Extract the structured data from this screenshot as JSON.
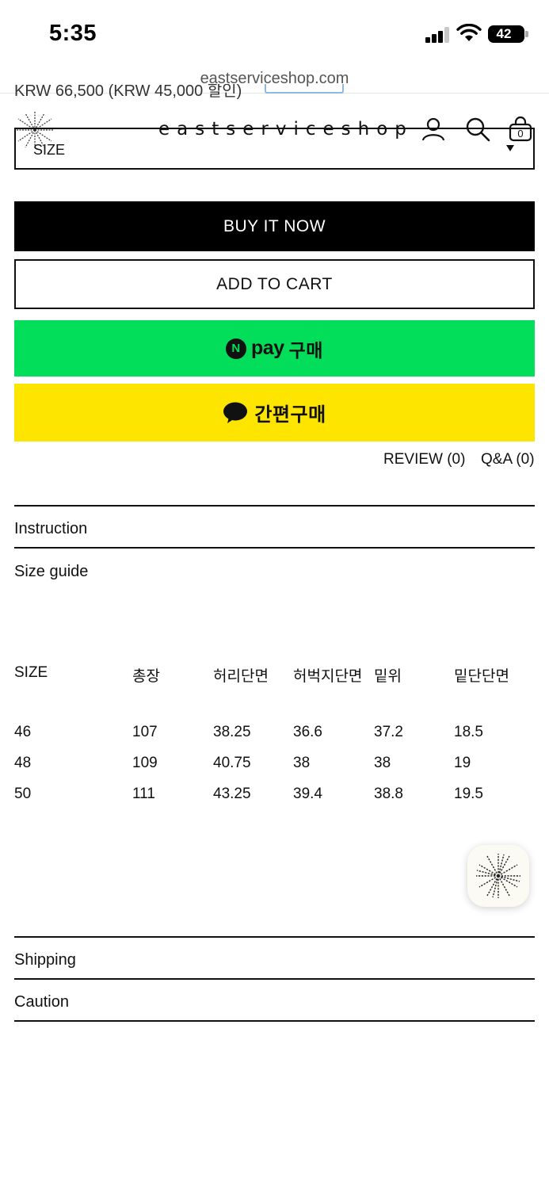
{
  "status_bar": {
    "time": "5:35",
    "battery": "42"
  },
  "browser": {
    "url": "eastserviceshop.com"
  },
  "product": {
    "price_partial": "KRW 66,500 (KRW 45,000 할인)"
  },
  "header": {
    "brand": "eastserviceshop",
    "cart_count": "0"
  },
  "options": {
    "size_select_label": "SIZE"
  },
  "actions": {
    "buy_now": "BUY IT NOW",
    "add_to_cart": "ADD TO CART",
    "npay_badge": "N",
    "npay_label": "pay",
    "npay_suffix": "구매",
    "kakao_label": "간편구매"
  },
  "links": {
    "review": "REVIEW (0)",
    "qna": "Q&A (0)"
  },
  "sections": {
    "instruction": "Instruction",
    "size_guide": "Size guide",
    "shipping": "Shipping",
    "caution": "Caution"
  },
  "size_table": {
    "headers": [
      "SIZE",
      "총장",
      "허리단면",
      "허벅지단면",
      "밑위",
      "밑단단면"
    ],
    "rows": [
      [
        "46",
        "107",
        "38.25",
        "36.6",
        "37.2",
        "18.5"
      ],
      [
        "48",
        "109",
        "40.75",
        "38",
        "38",
        "19"
      ],
      [
        "50",
        "111",
        "43.25",
        "39.4",
        "38.8",
        "19.5"
      ]
    ]
  },
  "icons": {
    "logo": "starburst-logo-icon",
    "account": "user-icon",
    "search": "search-icon",
    "cart": "shopping-bag-icon",
    "chat": "speech-bubble-icon"
  },
  "colors": {
    "npay_green": "#03de5a",
    "kakao_yellow": "#fee500",
    "buy_black": "#000000"
  }
}
